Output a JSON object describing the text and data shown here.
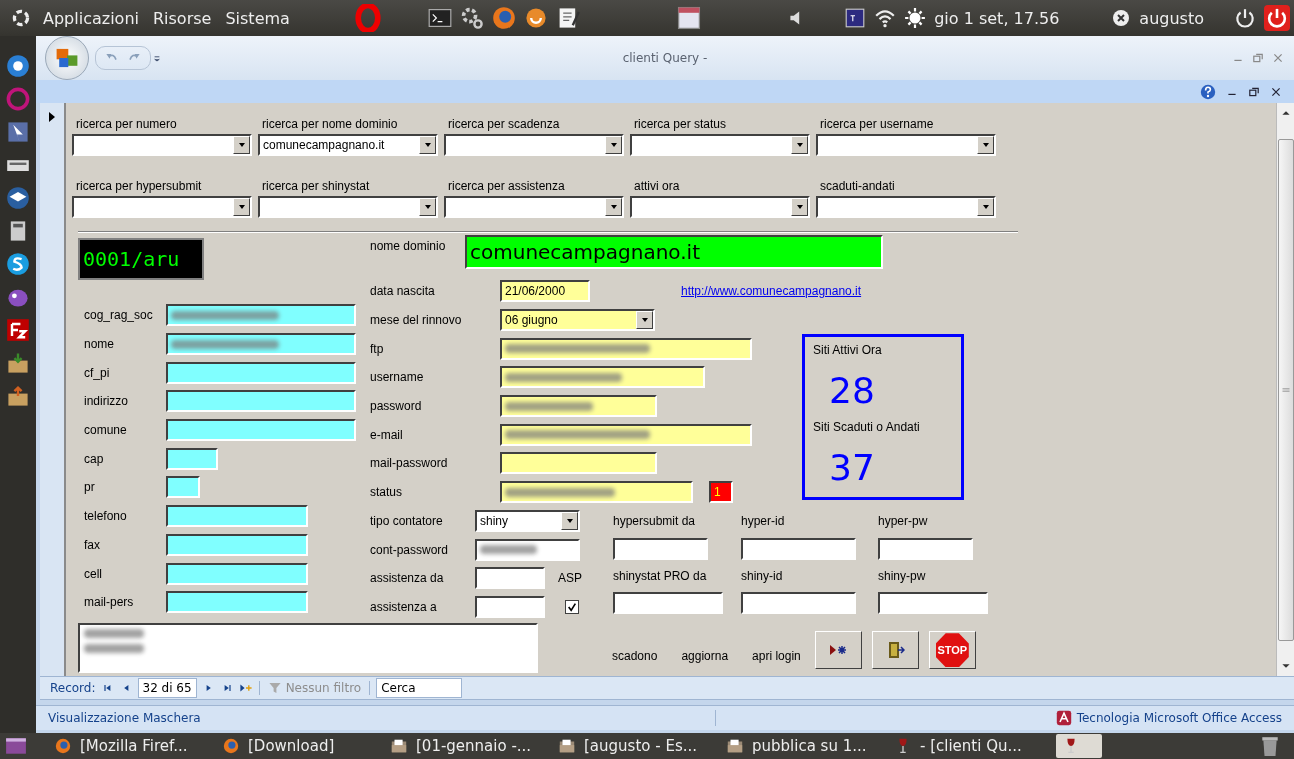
{
  "top_panel": {
    "menus": [
      "Applicazioni",
      "Risorse",
      "Sistema"
    ],
    "clock": "gio 1 set, 17.56",
    "user": "augusto"
  },
  "window": {
    "title": "clienti Query -"
  },
  "filters": [
    {
      "label": "ricerca per numero"
    },
    {
      "label": "ricerca per nome dominio",
      "value": "comunecampagnano.it"
    },
    {
      "label": "ricerca per scadenza"
    },
    {
      "label": "ricerca per status"
    },
    {
      "label": "ricerca per username"
    },
    {
      "label": "ricerca per hypersubmit"
    },
    {
      "label": "ricerca per shinystat"
    },
    {
      "label": "ricerca per assistenza"
    },
    {
      "label": "attivi ora"
    },
    {
      "label": "scaduti-andati"
    }
  ],
  "record_code": "0001/aru",
  "client_fields": [
    {
      "label": "cog_rag_soc",
      "redacted": true
    },
    {
      "label": "nome",
      "redacted": true
    },
    {
      "label": "cf_pi",
      "redacted": false
    },
    {
      "label": "indirizzo",
      "redacted": false
    },
    {
      "label": "comune",
      "redacted": false
    },
    {
      "label": "cap",
      "redacted": false
    },
    {
      "label": "pr",
      "redacted": false
    },
    {
      "label": "telefono",
      "redacted": false
    },
    {
      "label": "fax",
      "redacted": false
    },
    {
      "label": "cell",
      "redacted": false
    },
    {
      "label": "mail-pers",
      "redacted": false
    }
  ],
  "domain": {
    "label": "nome dominio",
    "value": "comunecampagnano.it"
  },
  "website_link": "http://www.comunecampagnano.it",
  "site_fields": [
    {
      "label": "data nascita",
      "kind": "text",
      "value": "21/06/2000",
      "redacted": false
    },
    {
      "label": "mese del rinnovo",
      "kind": "combo",
      "value": "06 giugno",
      "redacted": false
    },
    {
      "label": "ftp",
      "kind": "text",
      "redacted": true
    },
    {
      "label": "username",
      "kind": "text",
      "redacted": true
    },
    {
      "label": "password",
      "kind": "text",
      "redacted": true
    },
    {
      "label": "e-mail",
      "kind": "text",
      "redacted": true
    },
    {
      "label": "mail-password",
      "kind": "text",
      "redacted": false
    },
    {
      "label": "status",
      "kind": "text",
      "redacted": true,
      "badge": "1"
    }
  ],
  "counter_fields": [
    {
      "label": "tipo contatore",
      "kind": "combo",
      "value": "shiny",
      "redacted": false
    },
    {
      "label": "cont-password",
      "kind": "text",
      "redacted": true
    },
    {
      "label": "assistenza da",
      "kind": "text",
      "redacted": false
    },
    {
      "label": "assistenza a",
      "kind": "text",
      "redacted": false
    }
  ],
  "asp": {
    "label": "ASP",
    "checked": true
  },
  "stats": [
    {
      "label": "Siti Attivi Ora",
      "value": "28"
    },
    {
      "label": "Siti Scaduti o Andati",
      "value": "37"
    }
  ],
  "services": [
    {
      "label": "hypersubmit da"
    },
    {
      "label": "hyper-id"
    },
    {
      "label": "hyper-pw"
    },
    {
      "label": "shinystat PRO da"
    },
    {
      "label": "shiny-id"
    },
    {
      "label": "shiny-pw"
    }
  ],
  "notes": {
    "redacted": true
  },
  "actions": {
    "labels": [
      "scadono",
      "aggiorna",
      "apri login"
    ],
    "stop_sign": "STOP"
  },
  "record_nav": {
    "label": "Record:",
    "position": "32 di 65",
    "filter": "Nessun filtro",
    "search": "Cerca"
  },
  "status_bar": {
    "view": "Visualizzazione Maschera",
    "product": "Tecnologia Microsoft Office Access"
  },
  "taskbar": [
    {
      "label": "[Mozilla Firef...",
      "kind": "browser",
      "selected": false
    },
    {
      "label": "[Download]",
      "kind": "browser",
      "selected": false
    },
    {
      "label": "[01-gennaio -...",
      "kind": "folder",
      "selected": false
    },
    {
      "label": "[augusto - Es...",
      "kind": "folder",
      "selected": false
    },
    {
      "label": "pubblica su 1...",
      "kind": "folder",
      "selected": false
    },
    {
      "label": "- [clienti Qu...",
      "kind": "wine",
      "selected": false
    },
    {
      "kind": "wine",
      "selected": true
    }
  ]
}
